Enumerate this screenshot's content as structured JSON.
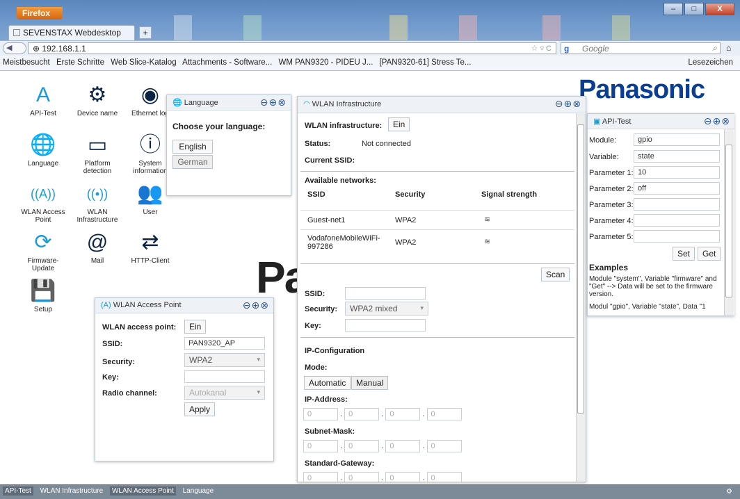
{
  "browser": {
    "app_button": "Firefox",
    "tab_title": "SEVENSTAX Webdesktop",
    "new_tab": "+",
    "url": "192.168.1.1",
    "search_engine_letter": "g",
    "search_placeholder": "Google",
    "bookmarks": [
      "Meistbesucht",
      "Erste Schritte",
      "Web Slice-Katalog",
      "Attachments - Software...",
      "WM PAN9320 - PIDEU J...",
      "[PAN9320-61] Stress Te..."
    ],
    "bookmarks_menu": "Lesezeichen",
    "window_controls": [
      "–",
      "□",
      "X"
    ]
  },
  "desktop": {
    "logo": "Panasonic",
    "bg_fragment": "Pa",
    "icons": [
      {
        "label": "API-Test",
        "glyph": "A"
      },
      {
        "label": "Device name",
        "glyph": "⚙"
      },
      {
        "label": "Ethernet log",
        "glyph": "◉"
      },
      {
        "label": "Language",
        "glyph": "🌐"
      },
      {
        "label": "Platform detection",
        "glyph": "▭"
      },
      {
        "label": "System information",
        "glyph": "ⓘ"
      },
      {
        "label": "WLAN Access Point",
        "glyph": "((A))"
      },
      {
        "label": "WLAN Infrastructure",
        "glyph": "((•))"
      },
      {
        "label": "User",
        "glyph": "👥"
      },
      {
        "label": "Firmware-Update",
        "glyph": "⟳"
      },
      {
        "label": "Mail",
        "glyph": "@"
      },
      {
        "label": "HTTP-Client",
        "glyph": "⇄"
      },
      {
        "label": "Setup",
        "glyph": "💾"
      }
    ]
  },
  "lang_win": {
    "title": "Language",
    "heading": "Choose your language:",
    "options": [
      "English",
      "German"
    ]
  },
  "ap_win": {
    "title": "WLAN Access Point",
    "ap_label": "WLAN access point:",
    "ap_value": "Ein",
    "ssid_label": "SSID:",
    "ssid_value": "PAN9320_AP",
    "security_label": "Security:",
    "security_value": "WPA2",
    "key_label": "Key:",
    "channel_label": "Radio channel:",
    "channel_value": "Autokanal",
    "apply": "Apply"
  },
  "infra_win": {
    "title": "WLAN Infrastructure",
    "infra_label": "WLAN infrastructure:",
    "infra_value": "Ein",
    "status_label": "Status:",
    "status_value": "Not connected",
    "ssid_current_label": "Current SSID:",
    "networks_label": "Available networks:",
    "columns": [
      "SSID",
      "Security",
      "Signal strength"
    ],
    "networks": [
      {
        "ssid": "Guest-net1",
        "security": "WPA2"
      },
      {
        "ssid": "VodafoneMobileWiFi-997286",
        "security": "WPA2"
      }
    ],
    "scan": "Scan",
    "ssid_label": "SSID:",
    "security_label": "Security:",
    "security_value": "WPA2 mixed",
    "key_label": "Key:",
    "ip_config": "IP-Configuration",
    "mode_label": "Mode:",
    "mode_auto": "Automatic",
    "mode_manual": "Manual",
    "ip_label": "IP-Address:",
    "mask_label": "Subnet-Mask:",
    "gw_label": "Standard-Gateway:",
    "octet": "0"
  },
  "api_win": {
    "title": "API-Test",
    "module_label": "Module:",
    "module_value": "gpio",
    "variable_label": "Variable:",
    "variable_value": "state",
    "p1_label": "Parameter 1:",
    "p1_value": "10",
    "p2_label": "Parameter 2:",
    "p2_value": "off",
    "p3_label": "Parameter 3:",
    "p4_label": "Parameter 4:",
    "p5_label": "Parameter 5:",
    "set": "Set",
    "get": "Get",
    "examples_title": "Examples",
    "example1": "Module \"system\", Variable \"firmware\" and \"Get\" --> Data will be set to the firmware version.",
    "example2": "Modul \"gpio\", Variable \"state\", Data \"1"
  },
  "taskbar": [
    "API-Test",
    "WLAN Infrastructure",
    "WLAN Access Point",
    "Language"
  ],
  "colors": {
    "accent": "#2c5a93",
    "brand": "#0a3e92",
    "titlebar": "#5a86bd"
  }
}
